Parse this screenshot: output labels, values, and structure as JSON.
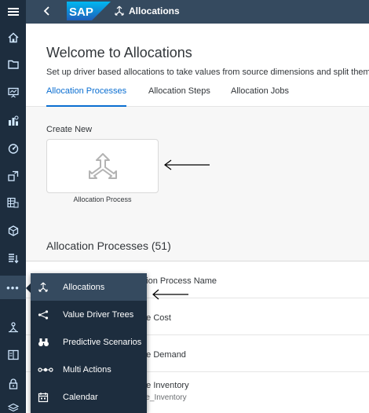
{
  "shell": {
    "logo_text": "SAP",
    "app_title": "Allocations",
    "colors": {
      "shell_bg": "#354a5f",
      "rail_bg": "#1d2d3e",
      "logo_blue": "#0a6ed1"
    }
  },
  "rail": {
    "items": [
      {
        "icon": "menu-icon"
      },
      {
        "icon": "home-icon"
      },
      {
        "icon": "folder-icon"
      },
      {
        "icon": "presentation-icon"
      },
      {
        "icon": "data-analyzer-icon"
      },
      {
        "icon": "gauge-icon"
      },
      {
        "icon": "tools-icon"
      },
      {
        "icon": "database-icon"
      },
      {
        "icon": "modeler-icon"
      },
      {
        "icon": "data-import-icon"
      },
      {
        "icon": "more-icon",
        "label": "•••"
      },
      {
        "icon": "workflow-icon"
      },
      {
        "icon": "catalog-icon"
      },
      {
        "icon": "security-icon"
      },
      {
        "icon": "layers-icon"
      }
    ]
  },
  "header": {
    "title": "Welcome to Allocations",
    "description": "Set up driver based allocations to take values from source dimensions and split them",
    "tabs": [
      {
        "label": "Allocation Processes",
        "active": true
      },
      {
        "label": "Allocation Steps",
        "active": false
      },
      {
        "label": "Allocation Jobs",
        "active": false
      }
    ]
  },
  "create": {
    "label": "Create New",
    "tile_label": "Allocation Process"
  },
  "list": {
    "title": "Allocation Processes (51)",
    "column_header": "ation Process Name",
    "rows": [
      {
        "title": "ate Cost",
        "subtitle": ""
      },
      {
        "title": "ate Demand",
        "subtitle": ""
      },
      {
        "title": "ate Inventory",
        "subtitle": "ate_Inventory"
      }
    ]
  },
  "menu": {
    "items": [
      {
        "label": "Allocations",
        "icon": "allocations-icon",
        "active": true
      },
      {
        "label": "Value Driver Trees",
        "icon": "value-driver-tree-icon",
        "active": false
      },
      {
        "label": "Predictive Scenarios",
        "icon": "binoculars-icon",
        "active": false
      },
      {
        "label": "Multi Actions",
        "icon": "multi-actions-icon",
        "active": false
      },
      {
        "label": "Calendar",
        "icon": "calendar-icon",
        "active": false
      }
    ]
  }
}
